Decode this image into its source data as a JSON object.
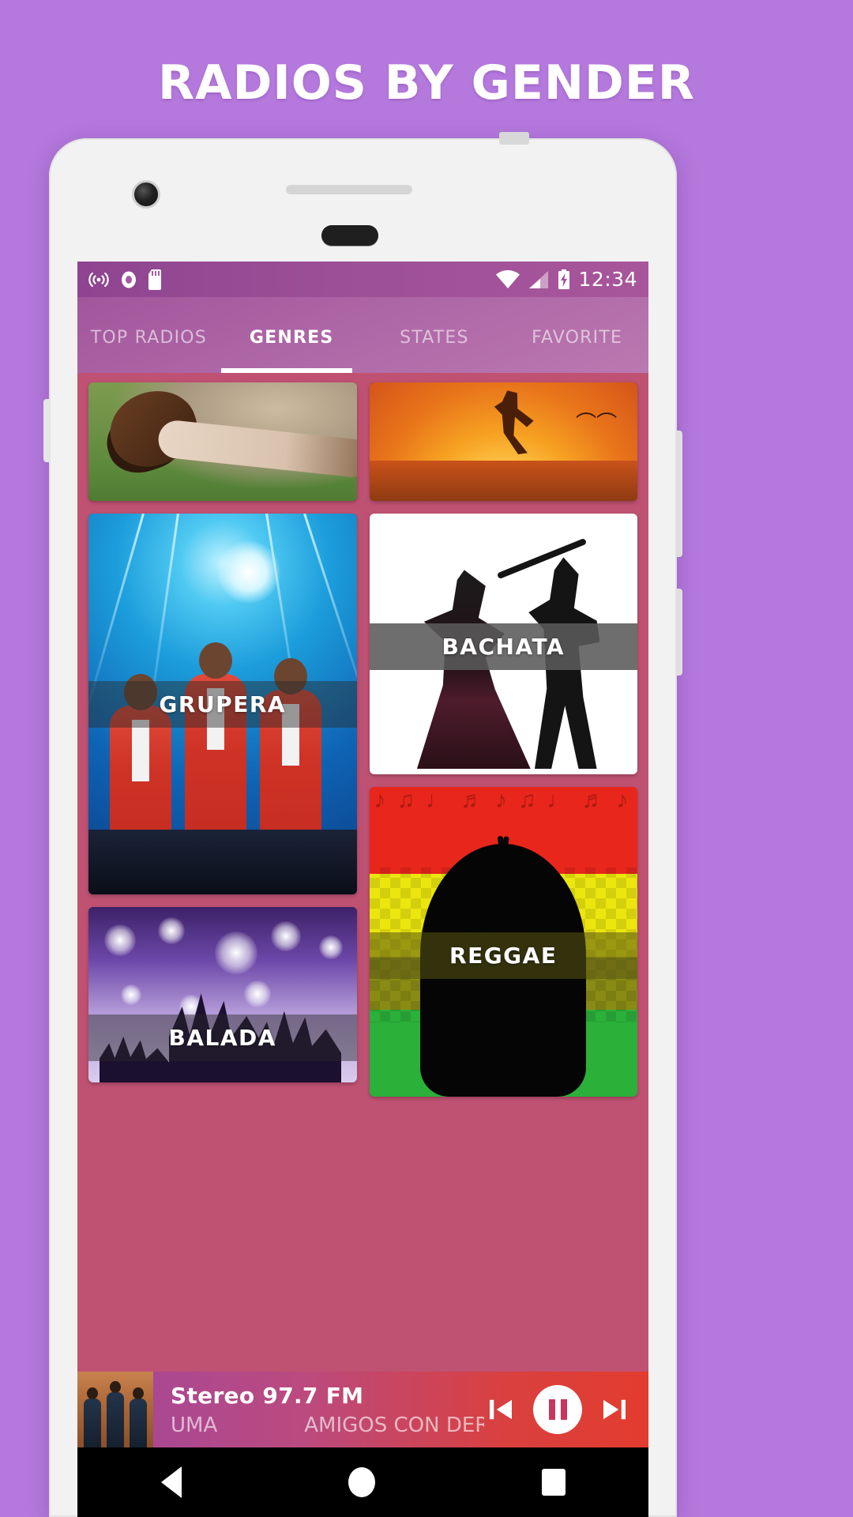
{
  "promo": {
    "title": "RADIOS BY GENDER",
    "background_color": "#b579dd"
  },
  "status_bar": {
    "time": "12:34",
    "left_icons": [
      "broadcast-icon",
      "record-icon",
      "sd-card-icon"
    ],
    "right_icons": [
      "wifi-icon",
      "signal-icon",
      "battery-charging-icon"
    ],
    "background_color": "#9c4f96"
  },
  "tabs": [
    {
      "label": "TOP RADIOS",
      "active": false
    },
    {
      "label": "GENRES",
      "active": true
    },
    {
      "label": "STATES",
      "active": false
    },
    {
      "label": "FAVORITE",
      "active": false
    }
  ],
  "genre_cards": {
    "left_column": [
      {
        "label": "",
        "art": "country-guitar-grass"
      },
      {
        "label": "GRUPERA",
        "art": "grupera-concert"
      },
      {
        "label": "BALADA",
        "art": "balada-concert-lights"
      }
    ],
    "right_column": [
      {
        "label": "",
        "art": "sunset-runner"
      },
      {
        "label": "BACHATA",
        "art": "bachata-dancers"
      },
      {
        "label": "REGGAE",
        "art": "reggae-rasta"
      }
    ]
  },
  "player": {
    "station": "Stereo 97.7 FM",
    "subtitle_left": "UMA",
    "subtitle_right": "AMIGOS CON DER",
    "prev_icon": "skip-previous-icon",
    "play_icon": "pause-icon",
    "next_icon": "skip-next-icon",
    "album_art": "band-photo"
  },
  "nav_bar": {
    "back": "back-triangle-icon",
    "home": "home-circle-icon",
    "recents": "recents-square-icon"
  }
}
